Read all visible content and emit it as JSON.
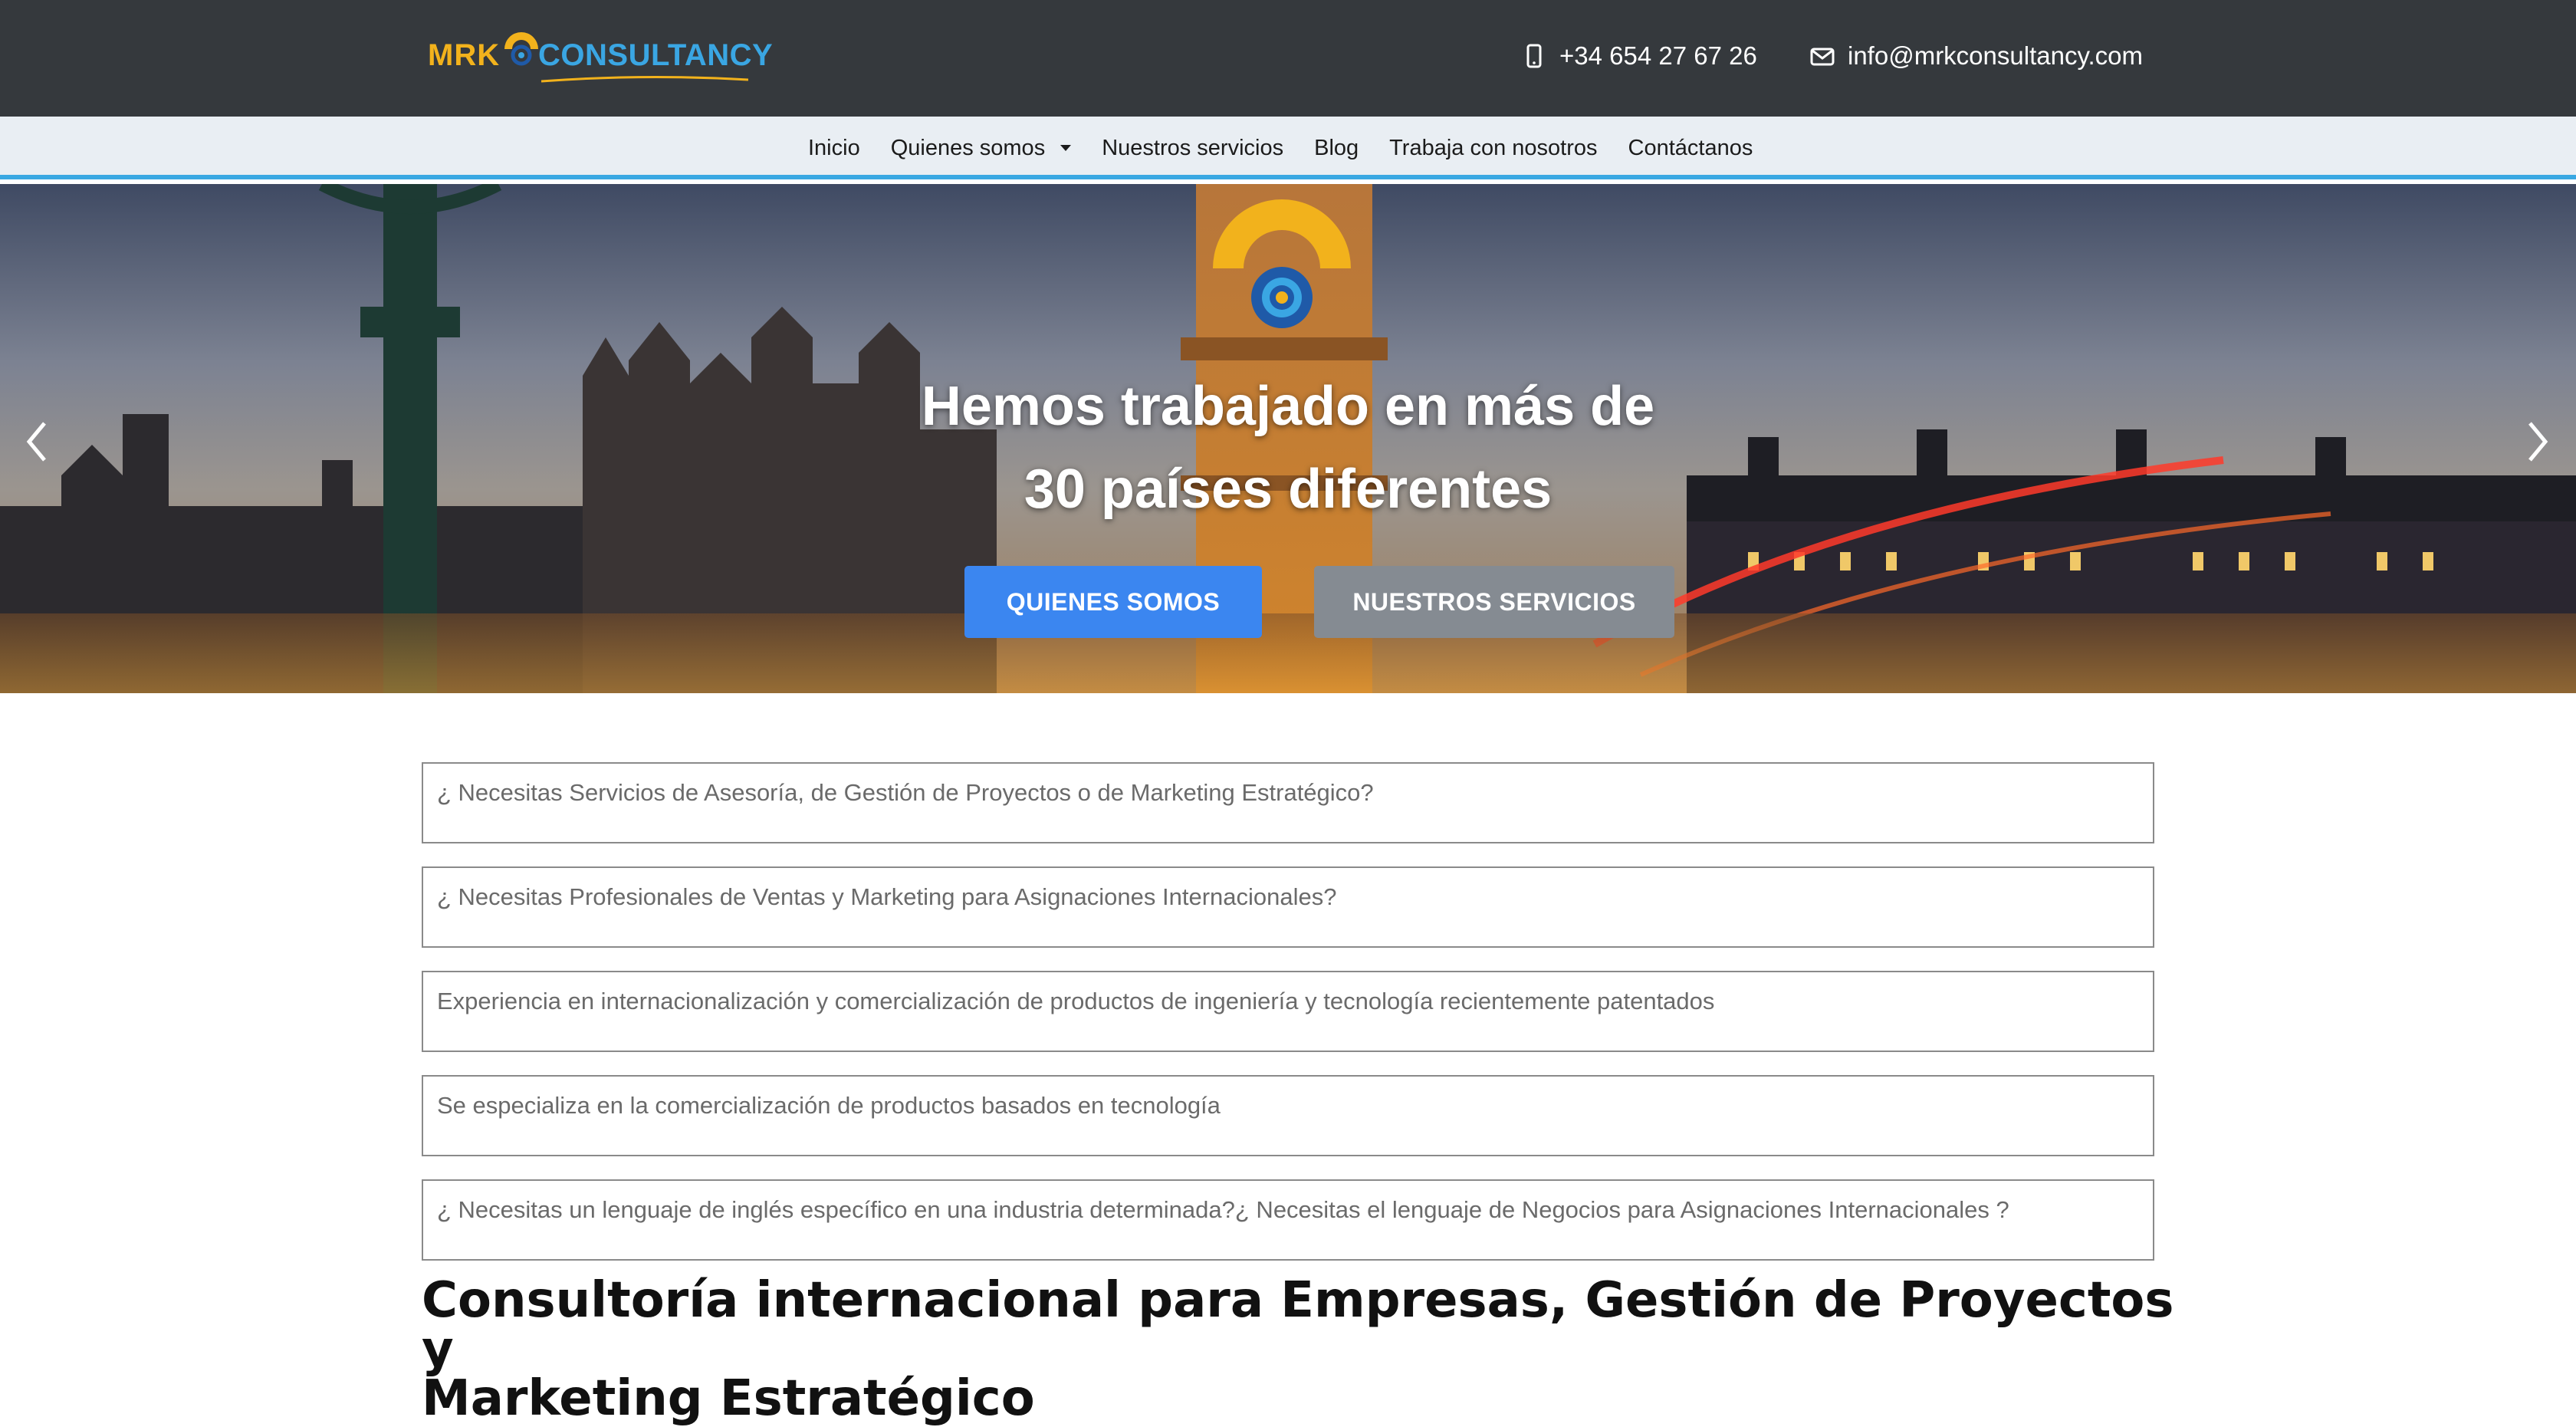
{
  "header": {
    "logo": {
      "brand_left": "MRK",
      "brand_right": "CONSULTANCY"
    },
    "phone": "+34 654 27 67 26",
    "email": "info@mrkconsultancy.com",
    "phone_icon": "mobile-phone-icon",
    "email_icon": "envelope-icon"
  },
  "nav": {
    "items": [
      {
        "label": "Inicio"
      },
      {
        "label": "Quienes somos",
        "has_dropdown": true
      },
      {
        "label": "Nuestros servicios"
      },
      {
        "label": "Blog"
      },
      {
        "label": "Trabaja con nosotros"
      },
      {
        "label": "Contáctanos"
      }
    ]
  },
  "hero": {
    "title_line1": "Hemos trabajado en más de",
    "title_line2": "30 países diferentes",
    "primary_button": "QUIENES SOMOS",
    "secondary_button": "NUESTROS SERVICIOS",
    "prev_icon": "chevron-left-icon",
    "next_icon": "chevron-right-icon"
  },
  "services": [
    "¿ Necesitas Servicios de Asesoría, de Gestión de Proyectos o de Marketing Estratégico?",
    "¿ Necesitas Profesionales de Ventas y Marketing para Asignaciones Internacionales?",
    "Experiencia en internacionalización y comercialización de productos de ingeniería y tecnología recientemente patentados",
    "Se especializa en la comercialización de productos basados en tecnología",
    "¿ Necesitas un lenguaje de inglés específico en una industria determinada?¿ Necesitas el lenguaje de Negocios para Asignaciones Internacionales ?"
  ],
  "section": {
    "title_line1": "Consultoría internacional para Empresas, Gestión de Proyectos y",
    "title_line2": "Marketing Estratégico"
  },
  "colors": {
    "topbar": "#35393d",
    "navbar": "#e9eef3",
    "accent_blue": "#39a8e2",
    "brand_yellow": "#f2b21c",
    "primary_button": "#3b86f0",
    "secondary_button": "#858b92"
  }
}
